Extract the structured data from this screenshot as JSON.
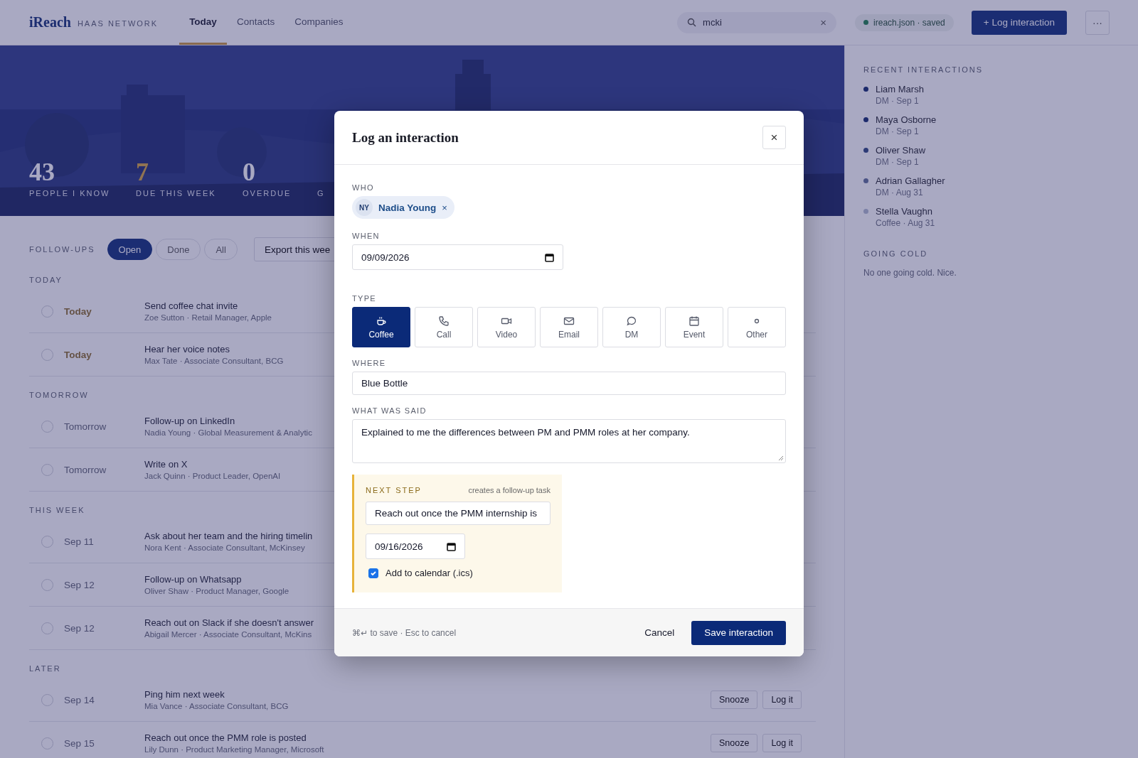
{
  "brand": {
    "name": "iReach",
    "subtitle": "HAAS NETWORK"
  },
  "nav": [
    {
      "label": "Today",
      "selected": true
    },
    {
      "label": "Contacts",
      "selected": false
    },
    {
      "label": "Companies",
      "selected": false
    }
  ],
  "search": {
    "value": "mcki",
    "clear": "×"
  },
  "save_status": "ireach.json · saved",
  "log_button": "+ Log interaction",
  "more_button": "···",
  "stats": [
    {
      "value": "43",
      "label": "PEOPLE I KNOW",
      "highlight": false
    },
    {
      "value": "7",
      "label": "DUE THIS WEEK",
      "highlight": true
    },
    {
      "value": "0",
      "label": "OVERDUE",
      "highlight": false
    },
    {
      "label": "G"
    }
  ],
  "followups": {
    "label": "FOLLOW-UPS",
    "filters": [
      {
        "label": "Open",
        "selected": true
      },
      {
        "label": "Done",
        "selected": false
      },
      {
        "label": "All",
        "selected": false
      }
    ],
    "export_button": "Export this wee",
    "groups": [
      {
        "title": "TODAY",
        "items": [
          {
            "done": false,
            "due": "Today",
            "urgent": true,
            "title": "Send coffee chat invite",
            "subtitle": "Zoe Sutton · Retail Manager, Apple"
          },
          {
            "done": false,
            "due": "Today",
            "urgent": true,
            "title": "Hear her voice notes",
            "subtitle": "Max Tate · Associate Consultant, BCG"
          }
        ]
      },
      {
        "title": "TOMORROW",
        "items": [
          {
            "done": false,
            "due": "Tomorrow",
            "urgent": false,
            "title": "Follow-up on LinkedIn",
            "subtitle": "Nadia Young · Global Measurement & Analytic"
          },
          {
            "done": false,
            "due": "Tomorrow",
            "urgent": false,
            "title": "Write on X",
            "subtitle": "Jack Quinn · Product Leader, OpenAI"
          }
        ]
      },
      {
        "title": "THIS WEEK",
        "items": [
          {
            "done": false,
            "due": "Sep 11",
            "urgent": false,
            "title": "Ask about her team and the hiring timelin",
            "subtitle": "Nora Kent · Associate Consultant, McKinsey"
          },
          {
            "done": false,
            "due": "Sep 12",
            "urgent": false,
            "title": "Follow-up on Whatsapp",
            "subtitle": "Oliver Shaw · Product Manager, Google"
          },
          {
            "done": false,
            "due": "Sep 12",
            "urgent": false,
            "title": "Reach out on Slack if she doesn't answer",
            "subtitle": "Abigail Mercer · Associate Consultant, McKins"
          }
        ]
      },
      {
        "title": "LATER",
        "items": [
          {
            "done": false,
            "due": "Sep 14",
            "urgent": false,
            "title": "Ping him next week",
            "subtitle": "Mia Vance · Associate Consultant, BCG",
            "actions": [
              "Snooze",
              "Log it"
            ]
          },
          {
            "done": false,
            "due": "Sep 15",
            "urgent": false,
            "title": "Reach out once the PMM role is posted",
            "subtitle": "Lily Dunn · Product Marketing Manager, Microsoft",
            "actions": [
              "Snooze",
              "Log it"
            ]
          }
        ]
      }
    ]
  },
  "sidebar": {
    "recent_title": "RECENT INTERACTIONS",
    "recent": [
      {
        "name": "Liam Marsh",
        "meta": "DM · Sep 1",
        "color": "#1c2a6c"
      },
      {
        "name": "Maya Osborne",
        "meta": "DM · Sep 1",
        "color": "#1c2a6c"
      },
      {
        "name": "Oliver Shaw",
        "meta": "DM · Sep 1",
        "color": "#2c3a76"
      },
      {
        "name": "Adrian Gallagher",
        "meta": "DM · Aug 31",
        "color": "#4a5385"
      },
      {
        "name": "Stella Vaughn",
        "meta": "Coffee · Aug 31",
        "color": "#7b80a6"
      }
    ],
    "cold_title": "GOING COLD",
    "cold_text": "No one going cold. Nice."
  },
  "modal": {
    "title": "Log an interaction",
    "close": "×",
    "who": {
      "label": "WHO",
      "initials": "NY",
      "name": "Nadia Young",
      "remove": "×"
    },
    "when": {
      "label": "WHEN",
      "value": "09/09/2026"
    },
    "type": {
      "label": "TYPE",
      "options": [
        {
          "kind": "coffee",
          "label": "Coffee",
          "selected": true
        },
        {
          "kind": "call",
          "label": "Call",
          "selected": false
        },
        {
          "kind": "video",
          "label": "Video",
          "selected": false
        },
        {
          "kind": "email",
          "label": "Email",
          "selected": false
        },
        {
          "kind": "dm",
          "label": "DM",
          "selected": false
        },
        {
          "kind": "event",
          "label": "Event",
          "selected": false
        },
        {
          "kind": "other",
          "label": "Other",
          "selected": false
        }
      ]
    },
    "where": {
      "label": "WHERE",
      "value": "Blue Bottle"
    },
    "notes": {
      "label": "WHAT WAS SAID",
      "value": "Explained to me the differences between PM and PMM roles at her company."
    },
    "next_step": {
      "label": "NEXT STEP",
      "hint": "creates a follow-up task",
      "task": "Reach out once the PMM internship is",
      "date": "09/16/2026",
      "calendar": {
        "label": "Add to calendar (.ics)",
        "checked": true
      }
    },
    "footer": {
      "hint": "⌘↵ to save · Esc to cancel",
      "cancel": "Cancel",
      "save": "Save interaction"
    }
  }
}
